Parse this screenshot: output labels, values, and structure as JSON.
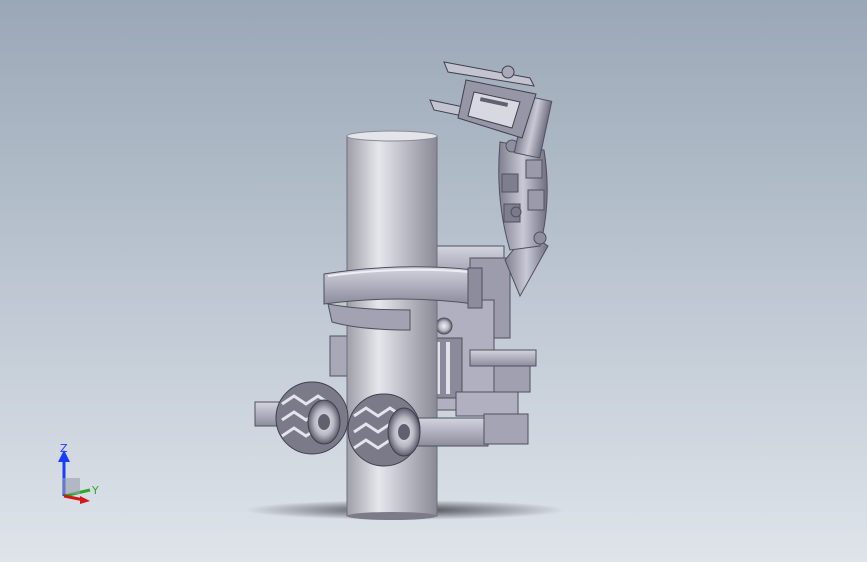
{
  "viewport": {
    "background_top": "#9aa7b6",
    "background_bottom": "#dfe4ea"
  },
  "model": {
    "parts": [
      "pole",
      "clamp-band",
      "drive-wheel-left",
      "drive-wheel-right",
      "robot-body",
      "manipulator-arm",
      "gripper"
    ],
    "colors": {
      "metal": "#b8b8c8",
      "metal_dark": "#6e6e80",
      "pole": "#d0d0d8"
    }
  },
  "triad": {
    "z_label": "Z",
    "y_label": "Y",
    "z_color": "#1a3cff",
    "y_color": "#2da82d",
    "x_color": "#d01818"
  }
}
